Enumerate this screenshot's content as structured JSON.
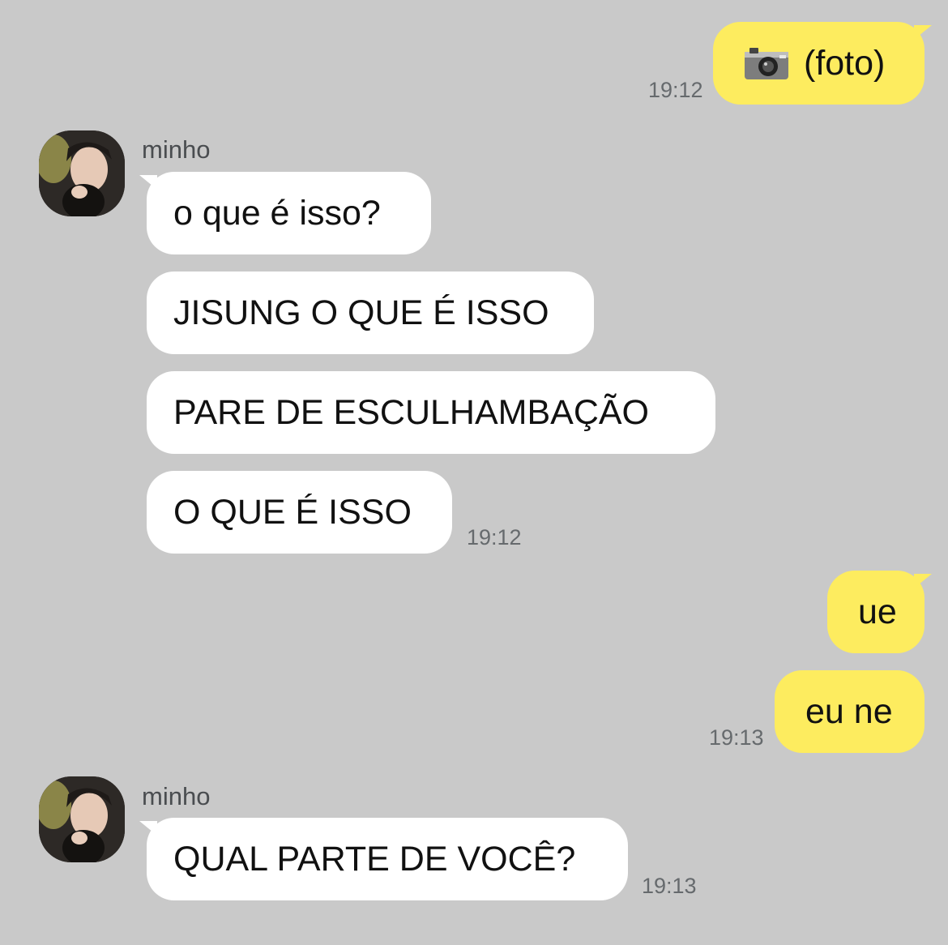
{
  "chat": {
    "messages": [
      {
        "id": "m1",
        "side": "out",
        "icon": "camera-icon",
        "text": "(foto)",
        "time": "19:12"
      },
      {
        "id": "m2",
        "side": "in",
        "sender": "minho",
        "text": "o que é isso?"
      },
      {
        "id": "m3",
        "side": "in",
        "text": "JISUNG O QUE É ISSO"
      },
      {
        "id": "m4",
        "side": "in",
        "text": "PARE DE ESCULHAMBAÇÃO"
      },
      {
        "id": "m5",
        "side": "in",
        "text": "O QUE É ISSO",
        "time": "19:12"
      },
      {
        "id": "m6",
        "side": "out",
        "text": "ue"
      },
      {
        "id": "m7",
        "side": "out",
        "text": "eu ne",
        "time": "19:13"
      },
      {
        "id": "m8",
        "side": "in",
        "sender": "minho",
        "text": "QUAL PARTE DE VOCÊ?",
        "time": "19:13"
      }
    ]
  },
  "colors": {
    "background": "#c9c9c9",
    "incoming_bubble": "#ffffff",
    "outgoing_bubble": "#fdec5f"
  }
}
